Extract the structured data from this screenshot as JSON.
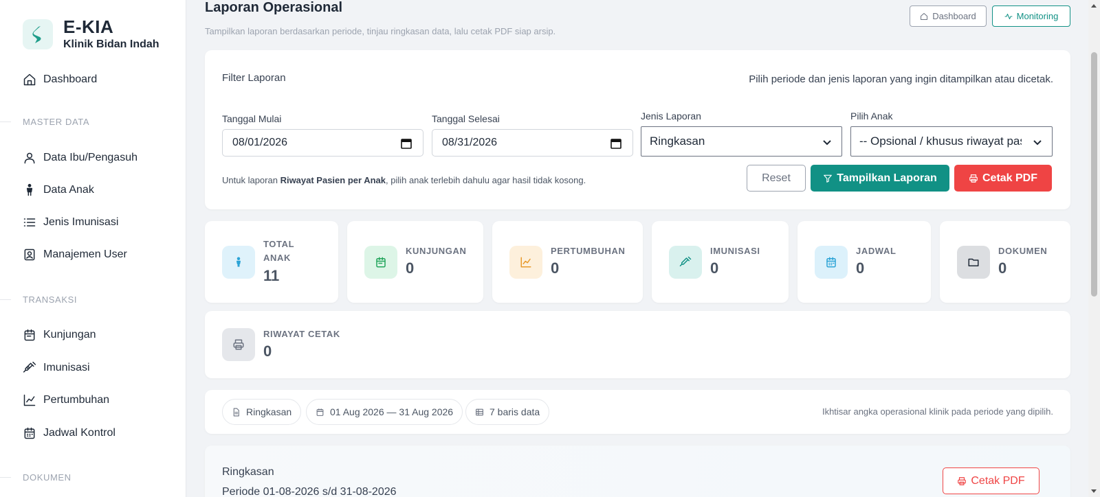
{
  "brand": {
    "title": "E-KIA",
    "subtitle": "Klinik Bidan Indah"
  },
  "sidebar": {
    "dashboard": "Dashboard",
    "sections": {
      "master": "MASTER DATA",
      "transaksi": "TRANSAKSI",
      "dokumen": "DOKUMEN"
    },
    "master_items": [
      "Data Ibu/Pengasuh",
      "Data Anak",
      "Jenis Imunisasi",
      "Manajemen User"
    ],
    "transaksi_items": [
      "Kunjungan",
      "Imunisasi",
      "Pertumbuhan",
      "Jadwal Kontrol"
    ]
  },
  "header": {
    "title": "Laporan Operasional",
    "subtitle": "Tampilkan laporan berdasarkan periode, tinjau ringkasan data, lalu cetak PDF siap arsip.",
    "dashboard_btn": "Dashboard",
    "monitoring_btn": "Monitoring"
  },
  "filter": {
    "title": "Filter Laporan",
    "hint": "Pilih periode dan jenis laporan yang ingin ditampilkan atau dicetak.",
    "start_label": "Tanggal Mulai",
    "start_value": "08/01/2026",
    "end_label": "Tanggal Selesai",
    "end_value": "08/31/2026",
    "type_label": "Jenis Laporan",
    "type_value": "Ringkasan",
    "child_label": "Pilih Anak",
    "child_value": "-- Opsional / khusus riwayat pasien --",
    "note_prefix": "Untuk laporan ",
    "note_bold": "Riwayat Pasien per Anak",
    "note_suffix": ", pilih anak terlebih dahulu agar hasil tidak kosong.",
    "reset_btn": "Reset",
    "show_btn": "Tampilkan Laporan",
    "print_btn": "Cetak PDF"
  },
  "stats": {
    "total_anak": {
      "label1": "TOTAL",
      "label2": "ANAK",
      "value": "11"
    },
    "kunjungan": {
      "label": "KUNJUNGAN",
      "value": "0"
    },
    "pertumbuhan": {
      "label": "PERTUMBUHAN",
      "value": "0"
    },
    "imunisasi": {
      "label": "IMUNISASI",
      "value": "0"
    },
    "jadwal": {
      "label": "JADWAL",
      "value": "0"
    },
    "dokumen": {
      "label": "DOKUMEN",
      "value": "0"
    },
    "riwayat_cetak": {
      "label": "RIWAYAT CETAK",
      "value": "0"
    }
  },
  "chips": {
    "type": "Ringkasan",
    "range": "01 Aug 2026 — 31 Aug 2026",
    "rows": "7 baris data",
    "hint": "Ikhtisar angka operasional klinik pada periode yang dipilih."
  },
  "summary": {
    "title": "Ringkasan",
    "period": "Periode 01-08-2026 s/d 31-08-2026",
    "print_btn": "Cetak PDF"
  },
  "colors": {
    "primary": "#119185",
    "danger": "#ef4444"
  }
}
